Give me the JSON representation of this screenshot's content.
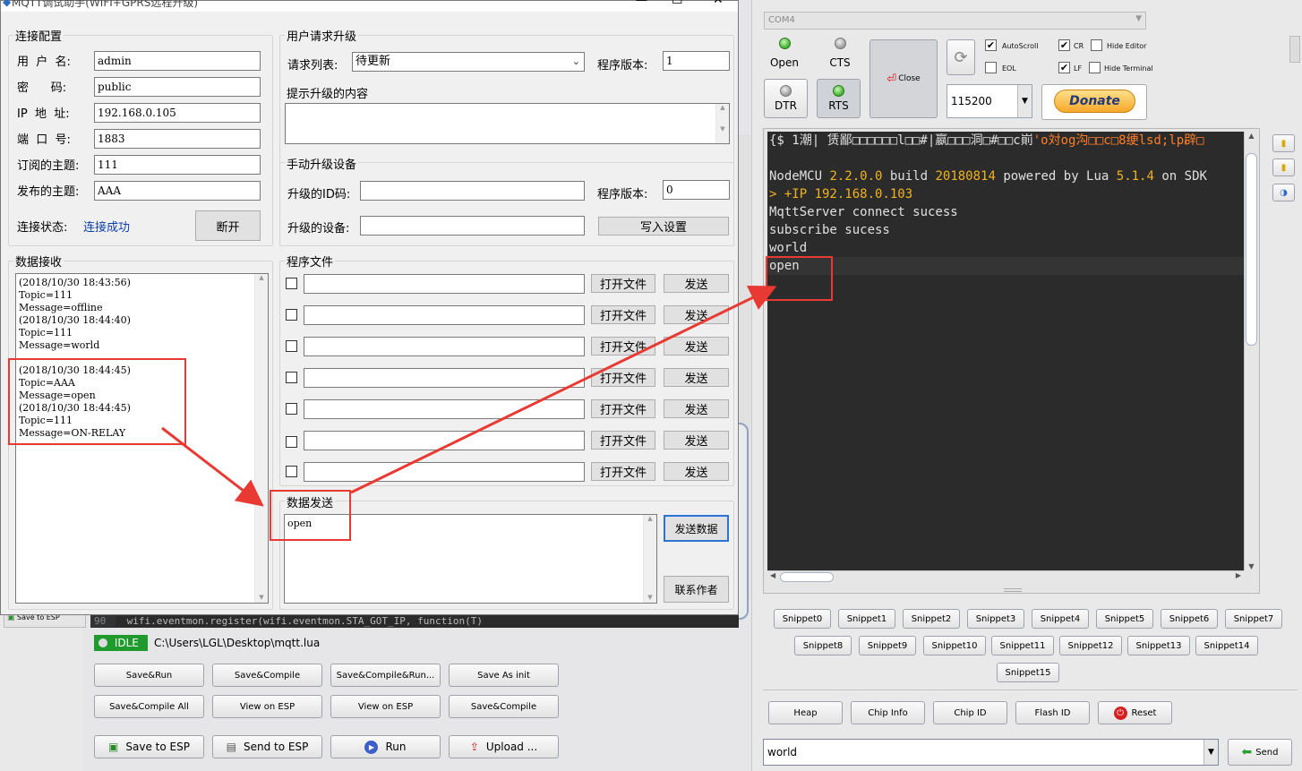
{
  "esplorer": {
    "port_select": "COM4",
    "status_buttons": {
      "open": "Open",
      "cts": "CTS",
      "dtr": "DTR",
      "rts": "RTS",
      "close": "Close"
    },
    "options": {
      "autoscroll": "AutoScroll",
      "cr": "CR",
      "hide_editor": "Hide Editor",
      "eol": "EOL",
      "lf": "LF",
      "hide_terminal": "Hide Terminal"
    },
    "baud": "115200",
    "donate": "Donate",
    "terminal_lines": [
      {
        "segments": [
          {
            "t": "{$ 1潮| 赁鄙□□□□□□l□□#|嬴□□□洞□#□□c崱",
            "c": "n"
          },
          {
            "t": "'o対og沟□□c□8绠lsd;lp辟□",
            "c": "w"
          }
        ]
      },
      {
        "segments": [
          {
            "t": "",
            "c": "n"
          }
        ]
      },
      {
        "segments": [
          {
            "t": "NodeMCU ",
            "c": "n"
          },
          {
            "t": "2.2.0.0",
            "c": "o"
          },
          {
            "t": " build ",
            "c": "n"
          },
          {
            "t": "20180814",
            "c": "o"
          },
          {
            "t": " powered by Lua ",
            "c": "n"
          },
          {
            "t": "5.1.4",
            "c": "o"
          },
          {
            "t": " on SDK",
            "c": "n"
          }
        ]
      },
      {
        "segments": [
          {
            "t": "> +IP ",
            "c": "o"
          },
          {
            "t": "192.168.0.103",
            "c": "o"
          }
        ]
      },
      {
        "segments": [
          {
            "t": "MqttServer connect sucess",
            "c": "n"
          }
        ]
      },
      {
        "segments": [
          {
            "t": "subscribe sucess",
            "c": "n"
          }
        ]
      },
      {
        "segments": [
          {
            "t": "world",
            "c": "n"
          }
        ]
      },
      {
        "segments": [
          {
            "t": "open",
            "c": "n"
          }
        ]
      }
    ],
    "snippets": [
      "Snippet0",
      "Snippet1",
      "Snippet2",
      "Snippet3",
      "Snippet4",
      "Snippet5",
      "Snippet6",
      "Snippet7",
      "Snippet8",
      "Snippet9",
      "Snippet10",
      "Snippet11",
      "Snippet12",
      "Snippet13",
      "Snippet14",
      "Snippet15"
    ],
    "bottom_buttons": {
      "heap": "Heap",
      "chip_info": "Chip Info",
      "chip_id": "Chip ID",
      "flash_id": "Flash ID",
      "reset": "Reset"
    },
    "send_input": "world",
    "send_button": "Send",
    "editor_line_number": "90",
    "editor_code": "wifi.eventmon.register(wifi.eventmon.STA_GOT_IP, function(T)",
    "save_to_esp_tab": "Save to ESP",
    "idle_status": "IDLE",
    "file_path": "C:\\Users\\LGL\\Desktop\\mqtt.lua",
    "action_buttons": [
      "Save&Run",
      "Save&Compile",
      "Save&Compile&Run...",
      "Save As init",
      "Save&Compile All",
      "View on ESP",
      "View on ESP",
      "Save&Compile"
    ],
    "toolbar_buttons": {
      "save_to_esp": "Save to ESP",
      "send_to_esp": "Send to ESP",
      "run": "Run",
      "upload": "Upload ..."
    }
  },
  "mqtt": {
    "window_title": "MQTT调试助手(WIFI+GPRS远程升级)",
    "conn_group": "连接配置",
    "username_label": "用  户  名:",
    "username": "admin",
    "password_label": "密      码:",
    "password": "public",
    "ip_label": "IP  地  址:",
    "ip": "192.168.0.105",
    "port_label": "端  口  号:",
    "port": "1883",
    "sub_topic_label": "订阅的主题:",
    "sub_topic": "111",
    "pub_topic_label": "发布的主题:",
    "pub_topic": "AAA",
    "status_label": "连接状态:",
    "status_value": "连接成功",
    "disconnect": "断开",
    "upgrade_group": "用户请求升级",
    "request_list_label": "请求列表:",
    "request_list_value": "待更新",
    "version_label": "程序版本:",
    "version_value": "1",
    "hint_group": "提示升级的内容",
    "manual_group": "手动升级设备",
    "upgrade_id_label": "升级的ID码:",
    "manual_version_label": "程序版本:",
    "manual_version_value": "0",
    "upgrade_device_label": "升级的设备:",
    "write_settings": "写入设置",
    "recv_group": "数据接收",
    "recv_lines_top": [
      "(2018/10/30 18:43:56)",
      "Topic=111",
      "Message=offline",
      "(2018/10/30 18:44:40)",
      "Topic=111",
      "Message=world"
    ],
    "recv_lines_bottom": [
      "(2018/10/30 18:44:45)",
      "Topic=AAA",
      "Message=open",
      "(2018/10/30 18:44:45)",
      "Topic=111",
      "Message=ON-RELAY"
    ],
    "file_group": "程序文件",
    "open_file": "打开文件",
    "send": "发送",
    "send_group": "数据发送",
    "send_text": "open",
    "send_data": "发送数据",
    "contact_author": "联系作者"
  },
  "colors": {
    "annotation_red": "#e83a33",
    "terminal_bg": "#2b2b2b",
    "terminal_number": "#f1b320",
    "link_blue": "#0b3fa8",
    "donate_orange": "#f7a82a"
  }
}
